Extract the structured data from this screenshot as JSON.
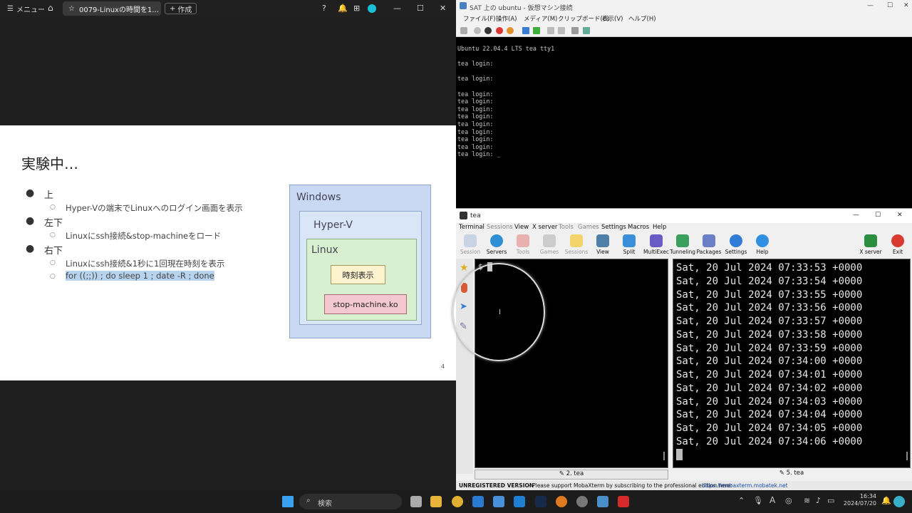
{
  "browser": {
    "menu_label": "メニュー",
    "tab_title": "0079-Linuxの時間を1...",
    "new_label": "作成"
  },
  "slide": {
    "title": "実験中…",
    "bullets": [
      {
        "label": "上",
        "sub": [
          "Hyper-Vの端末でLinuxへのログイン画面を表示"
        ]
      },
      {
        "label": "左下",
        "sub": [
          "Linuxにssh接続&stop-machineをロード"
        ]
      },
      {
        "label": "右下",
        "sub": [
          "Linuxにssh接続&1秒に1回現在時刻を表示",
          "for ((;;)) ; do sleep 1 ; date -R ; done"
        ]
      }
    ],
    "diagram": {
      "windows": "Windows",
      "hyperv": "Hyper-V",
      "linux": "Linux",
      "clock": "時刻表示",
      "stop": "stop-machine.ko"
    },
    "page_number": "4"
  },
  "vm": {
    "title": "SAT 上の ubuntu - 仮想マシン接続",
    "menu": [
      "ファイル(F)",
      "操作(A)",
      "メディア(M)",
      "クリップボード(C)",
      "表示(V)",
      "ヘルプ(H)"
    ],
    "console_lines": [
      "Ubuntu 22.04.4 LTS tea tty1",
      "",
      "tea login:",
      "",
      "tea login:",
      "",
      "tea login:",
      "tea login:",
      "tea login:",
      "tea login:",
      "tea login:",
      "tea login:",
      "tea login:",
      "tea login:",
      "tea login: _"
    ]
  },
  "moba": {
    "title": "tea",
    "menu": [
      "Terminal",
      "Sessions",
      "View",
      "X server",
      "Tools",
      "Games",
      "Settings",
      "Macros",
      "Help"
    ],
    "toolbar": [
      "Session",
      "Servers",
      "Tools",
      "Games",
      "Sessions",
      "View",
      "Split",
      "MultiExec",
      "Tunneling",
      "Packages",
      "Settings",
      "Help"
    ],
    "xserver_label": "X server",
    "exit_label": "Exit",
    "left_prompt": "$",
    "left_tab": "2. tea",
    "right_tab": "5. tea",
    "date_lines": [
      "Sat, 20 Jul 2024 07:33:53 +0000",
      "Sat, 20 Jul 2024 07:33:54 +0000",
      "Sat, 20 Jul 2024 07:33:55 +0000",
      "Sat, 20 Jul 2024 07:33:56 +0000",
      "Sat, 20 Jul 2024 07:33:57 +0000",
      "Sat, 20 Jul 2024 07:33:58 +0000",
      "Sat, 20 Jul 2024 07:33:59 +0000",
      "Sat, 20 Jul 2024 07:34:00 +0000",
      "Sat, 20 Jul 2024 07:34:01 +0000",
      "Sat, 20 Jul 2024 07:34:02 +0000",
      "Sat, 20 Jul 2024 07:34:03 +0000",
      "Sat, 20 Jul 2024 07:34:04 +0000",
      "Sat, 20 Jul 2024 07:34:05 +0000",
      "Sat, 20 Jul 2024 07:34:06 +0000"
    ],
    "status_bold": "UNREGISTERED VERSION",
    "status_text": "- Please support MobaXterm by subscribing to the professional edition here:",
    "status_link": "https://mobaxterm.mobatek.net"
  },
  "taskbar": {
    "search_label": "検索",
    "time": "16:34",
    "date": "2024/07/20",
    "ime": "A"
  }
}
